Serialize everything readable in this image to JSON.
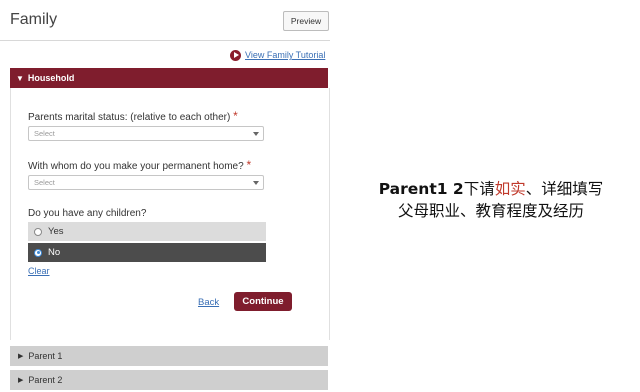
{
  "header": {
    "title": "Family",
    "preview_label": "Preview"
  },
  "tutorial": {
    "link_label": "View Family Tutorial"
  },
  "household": {
    "section_label": "Household",
    "marital_label": "Parents marital status: (relative to each other)",
    "marital_select": "Select",
    "home_label": "With whom do you make your permanent home?",
    "home_select": "Select",
    "required_mark": "*",
    "children_label": "Do you have any children?",
    "options": [
      {
        "label": "Yes",
        "selected": false
      },
      {
        "label": "No",
        "selected": true
      }
    ],
    "clear_label": "Clear",
    "back_label": "Back",
    "continue_label": "Continue"
  },
  "sections": [
    {
      "label": "Parent 1"
    },
    {
      "label": "Parent 2"
    }
  ],
  "caption": {
    "line1_bold": "Parent1 2",
    "line1_a": "下请",
    "line1_highlight": "如实",
    "line1_b": "、详细填写",
    "line2": "父母职业、教育程度及经历"
  },
  "colors": {
    "accent": "#7f1d2d",
    "link": "#3a6fb5",
    "highlight": "#c0392b"
  }
}
